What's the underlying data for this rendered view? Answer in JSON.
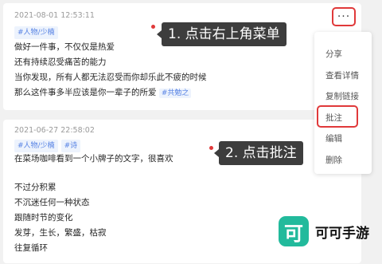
{
  "post1": {
    "timestamp": "2021-08-01 12:53:11",
    "tags": [
      "#人物/少楠"
    ],
    "lines": [
      "做好一件事，不仅仅是热爱",
      "还有持续忍受痛苦的能力",
      "当你发现，所有人都无法忍受而你却乐此不疲的时候",
      "那么这件事多半应该是你一辈子的所爱"
    ],
    "inline_tag": "#共勉之"
  },
  "post2": {
    "timestamp": "2021-06-27 22:58:02",
    "tags": [
      "#人物/少楠",
      "#诗"
    ],
    "lines": [
      "在菜场咖啡看到一个小牌子的文字，很喜欢",
      "",
      "不过分积累",
      "不沉迷任何一种状态",
      "跟随时节的变化",
      "发芽，生长，繁盛，枯寂",
      "往复循环"
    ]
  },
  "more_button": {
    "icon": "more-dots-icon",
    "label": "···"
  },
  "menu": {
    "items": [
      "分享",
      "查看详情",
      "复制链接",
      "批注",
      "编辑",
      "删除"
    ]
  },
  "callouts": {
    "step1": "1. 点击右上角菜单",
    "step2": "2. 点击批注"
  },
  "watermark": {
    "logo_char": "可",
    "name": "可可手游"
  },
  "colors": {
    "highlight_red": "#e0393a",
    "tag_blue": "#5682e4",
    "tag_bg": "#edf3fd",
    "callout_bg": "#3d3d3d",
    "brand_green": "#22ba9c"
  }
}
